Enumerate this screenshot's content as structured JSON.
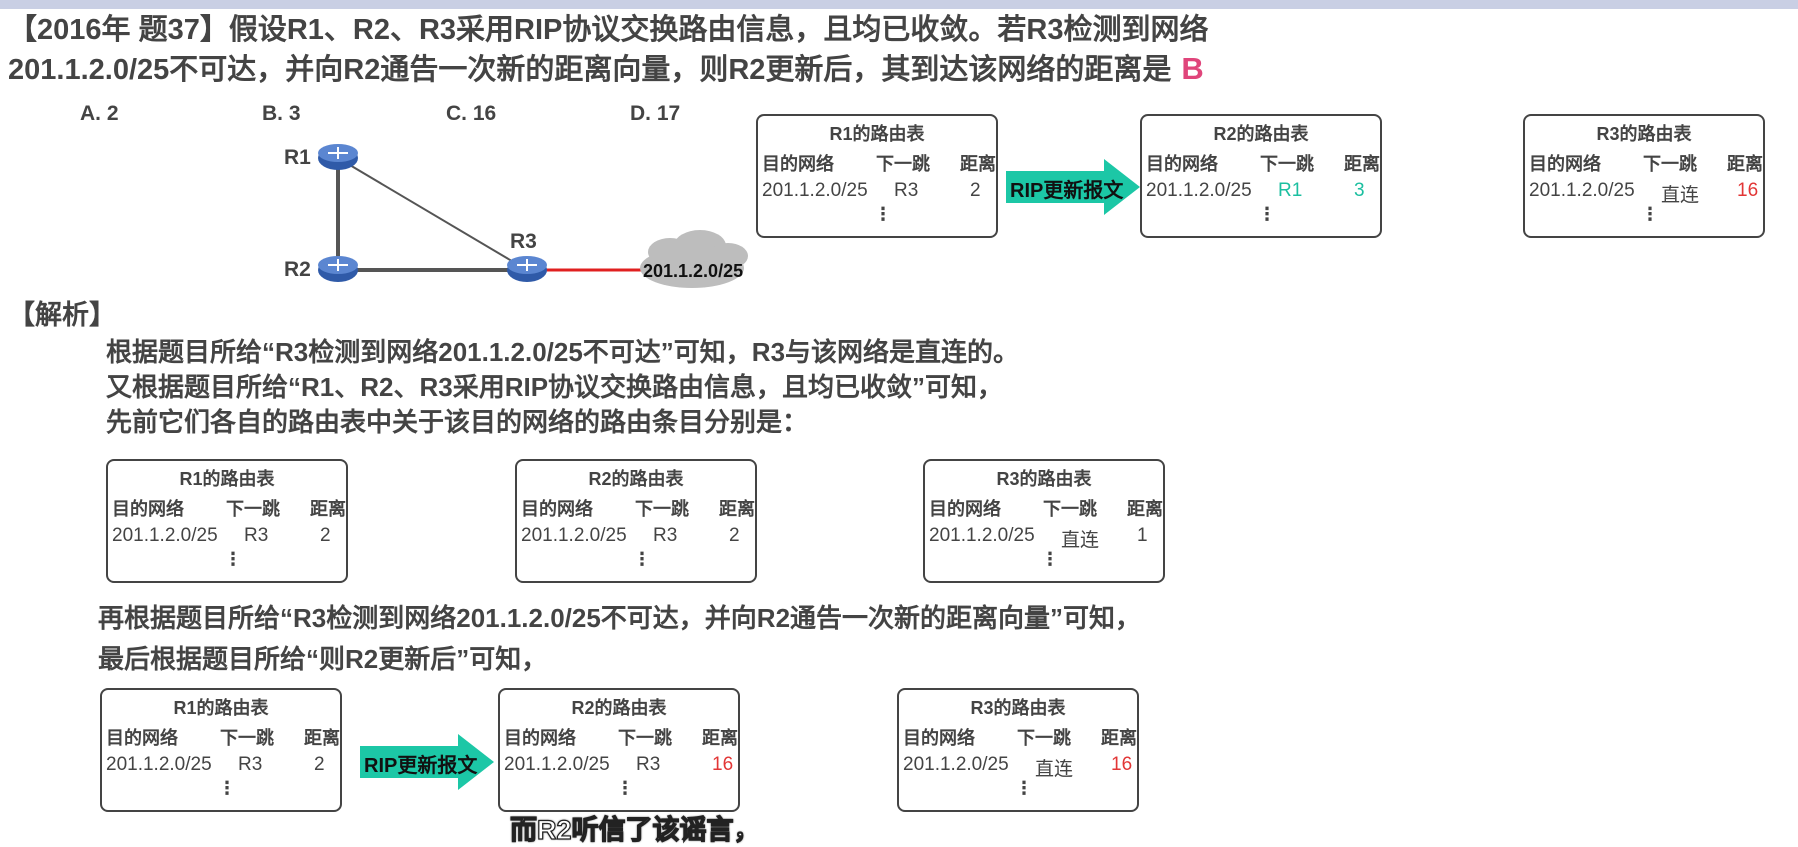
{
  "question": {
    "line1": "【2016年 题37】假设R1、R2、R3采用RIP协议交换路由信息，且均已收敛。若R3检测到网络",
    "line2": "201.1.2.0/25不可达，并向R2通告一次新的距离向量，则R2更新后，其到达该网络的距离是",
    "answer": "B"
  },
  "options": [
    "A. 2",
    "B. 3",
    "C. 16",
    "D. 17"
  ],
  "topology": {
    "routers": [
      "R1",
      "R2",
      "R3"
    ],
    "network": "201.1.2.0/25",
    "colors": {
      "router": "#2f5aa8",
      "link": "#555555",
      "failed_link": "#e02020",
      "cloud": "#bdbdbd"
    }
  },
  "tables": {
    "title_r1": "R1的路由表",
    "title_r2": "R2的路由表",
    "title_r3": "R3的路由表",
    "col_dest": "目的网络",
    "col_next": "下一跳",
    "col_dist": "距离",
    "dest": "201.1.2.0/25",
    "dots": "⋮",
    "top": {
      "r1": {
        "next": "R3",
        "dist": "2"
      },
      "r2": {
        "next": "R1",
        "dist": "3"
      },
      "r3": {
        "next": "直连",
        "dist": "16"
      }
    },
    "mid": {
      "r1": {
        "next": "R3",
        "dist": "2"
      },
      "r2": {
        "next": "R3",
        "dist": "2"
      },
      "r3": {
        "next": "直连",
        "dist": "1"
      }
    },
    "bottom": {
      "r1": {
        "next": "R3",
        "dist": "2"
      },
      "r2": {
        "next": "R3",
        "dist": "16"
      },
      "r3": {
        "next": "直连",
        "dist": "16"
      }
    }
  },
  "arrow_label": "RIP更新报文",
  "arrow_color": "#1cc7a6",
  "analysis": {
    "heading": "【解析】",
    "p1": "根据题目所给“R3检测到网络201.1.2.0/25不可达”可知，R3与该网络是直连的。",
    "p2": "又根据题目所给“R1、R2、R3采用RIP协议交换路由信息，且均已收敛”可知，",
    "p3": "先前它们各自的路由表中关于该目的网络的路由条目分别是：",
    "p4": "再根据题目所给“R3检测到网络201.1.2.0/25不可达，并向R2通告一次新的距离向量”可知，",
    "p5": "最后根据题目所给“则R2更新后”可知，"
  },
  "subtitle": "而R2听信了该谣言，"
}
